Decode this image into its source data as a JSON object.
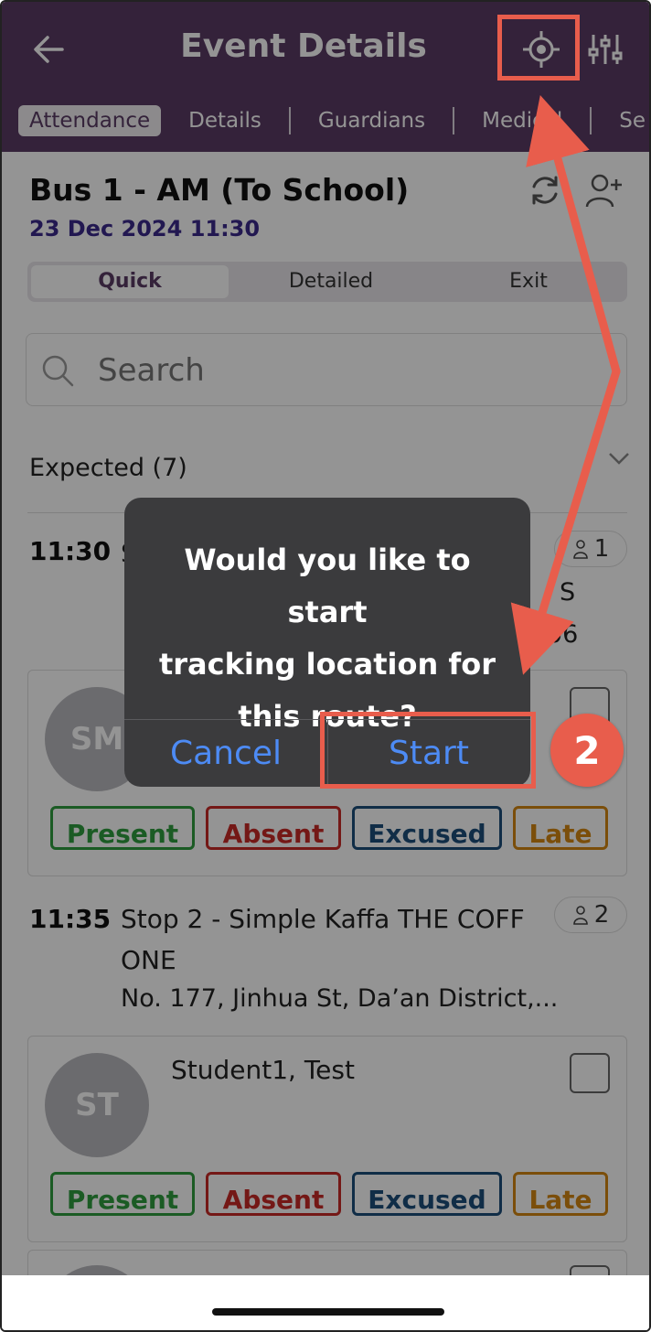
{
  "header": {
    "title": "Event Details",
    "tabs": [
      {
        "label": "Attendance"
      },
      {
        "label": "Details"
      },
      {
        "label": "Guardians"
      },
      {
        "label": "Medical"
      },
      {
        "label": "Se"
      }
    ]
  },
  "event": {
    "title": "Bus 1 - AM (To School)",
    "date": "23 Dec 2024 11:30"
  },
  "segments": [
    "Quick",
    "Detailed",
    "Exit"
  ],
  "search": {
    "placeholder": "Search"
  },
  "list": {
    "expected_label": "Expected (7)",
    "stops": [
      {
        "time": "11:30",
        "name": "S",
        "extra": "S",
        "addr": "06",
        "count": "1",
        "student": {
          "initials": "SM",
          "name": ""
        }
      },
      {
        "time": "11:35",
        "name": "Stop 2 - Simple Kaffa THE COFF ONE",
        "addr": "No. 177, Jinhua St, Da’an District,...",
        "count": "2",
        "student": {
          "initials": "ST",
          "name": "Student1, Test"
        }
      }
    ]
  },
  "status_buttons": {
    "present": "Present",
    "absent": "Absent",
    "excused": "Excused",
    "late": "Late"
  },
  "dialog": {
    "message_line1": "Would you like to start",
    "message_line2": "tracking location for",
    "message_line3": "this route?",
    "cancel": "Cancel",
    "start": "Start"
  },
  "annotation": {
    "step": "2",
    "color": "#e85d4c"
  },
  "colors": {
    "header": "#5a3b65",
    "present": "#2f9d3e",
    "absent": "#c82a26",
    "excused": "#1d4e7a",
    "late": "#d48712",
    "ios_blue": "#4d8bf5"
  }
}
